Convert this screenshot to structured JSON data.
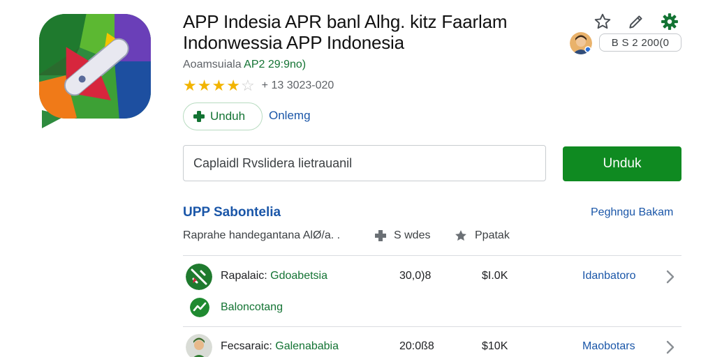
{
  "app": {
    "icon": "app-logo-icon",
    "title": "APP Indesia APR banl Alhg. kitz Faarlam Indonwessia APP Indonesia",
    "subtitle_prefix": "Aoamsuiala ",
    "subtitle_accent": "AP2 29:9no)",
    "rating_value": 3.5,
    "rating_max": 5,
    "rating_count": "+ 13 3023-020",
    "install_chip_label": "Unduh",
    "install_chip_icon": "plus-icon",
    "online_link": "Onlemg"
  },
  "header_actions": {
    "icons": [
      "star-outline-icon",
      "edit-icon",
      "settings-gear-icon"
    ],
    "avatar": "user-avatar",
    "version_badge": "B S 2 200(0"
  },
  "search": {
    "placeholder": "Caplaidl Rvslidera lietrauanil",
    "value": "",
    "button_label": "Unduk"
  },
  "section": {
    "title": "UPP Sabontelia",
    "link": "Peghngu Bakam",
    "meta": [
      {
        "icon": "",
        "label": "Raprahe handegantana AlØ/a. ."
      },
      {
        "icon": "puzzle-icon",
        "label": "S wdes"
      },
      {
        "icon": "star-icon",
        "label": "Ppatak"
      }
    ]
  },
  "list": [
    {
      "icon": "map-app-icon",
      "name_prefix": "Rapalaic: ",
      "name_highlight": "Gdoabetsia",
      "size": "30,0)8",
      "downloads": "$I.0K",
      "link": "Idanbatoro"
    },
    {
      "icon": "person-app-icon",
      "name_prefix": "Fecsaraic: ",
      "name_highlight": "Galenababia",
      "size": "20:0ß8",
      "downloads": "$10K",
      "link": "Maobotars"
    }
  ],
  "sub_item": {
    "icon": "chart-app-icon",
    "label": "Baloncotang"
  },
  "colors": {
    "primary_green": "#0f8a21",
    "accent_green": "#137333",
    "link_blue": "#1a56a8",
    "star_gold": "#f2b400"
  }
}
